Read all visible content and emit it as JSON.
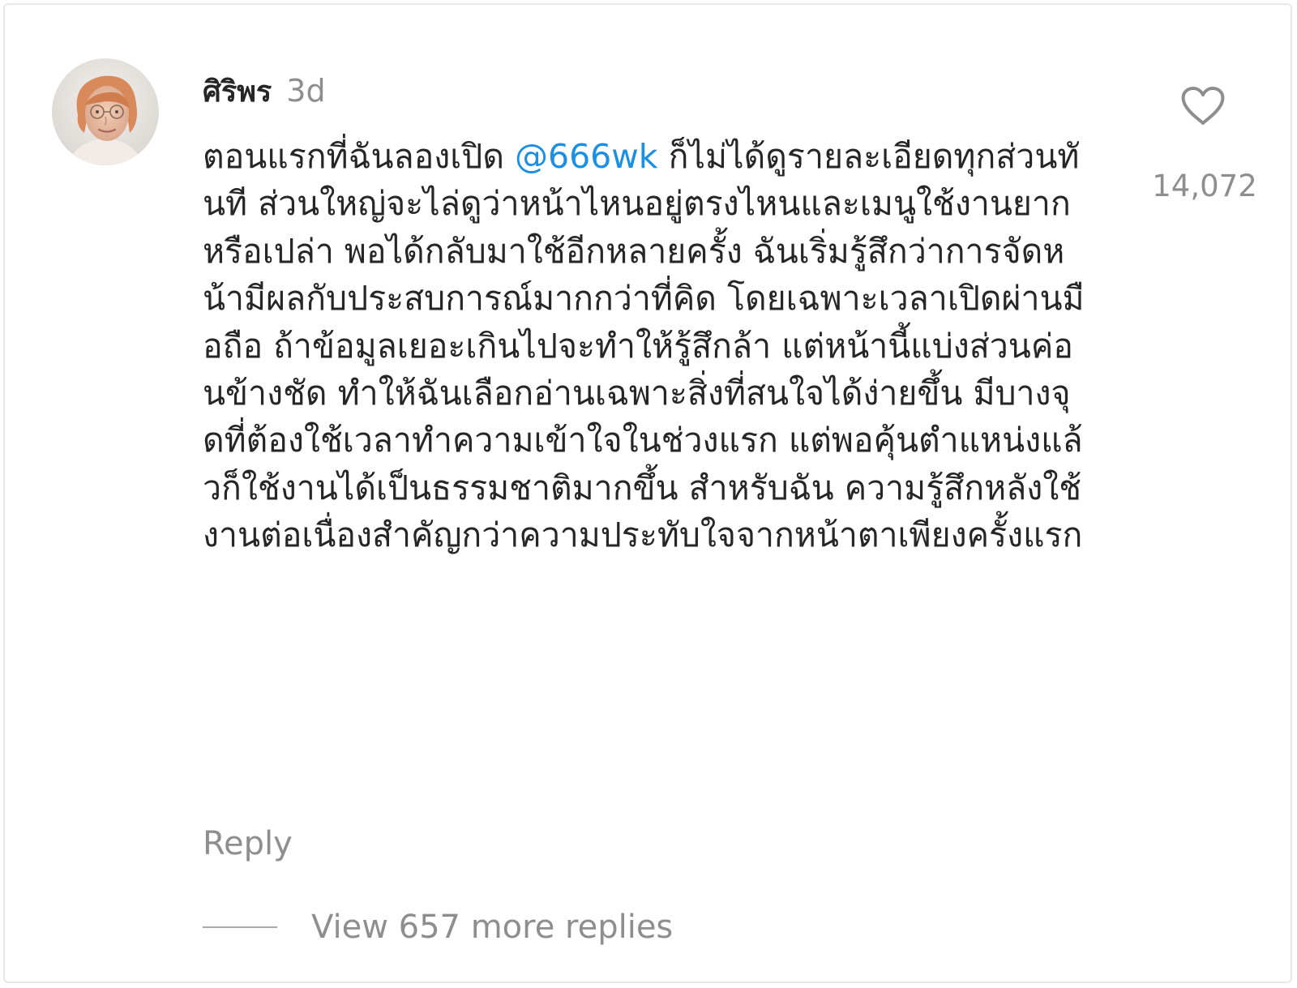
{
  "comment": {
    "username": "ศิริพร",
    "timestamp": "3d",
    "text_before_mention": "ตอนแรกที่ฉันลองเปิด ",
    "mention": "@666wk",
    "text_after_mention": " ก็ไม่ได้ดูรายละเอียดทุกส่วนทันที ส่วนใหญ่จะไล่ดูว่าหน้าไหนอยู่ตรงไหนและเมนูใช้งานยากหรือเปล่า พอได้กลับมาใช้อีกหลายครั้ง ฉันเริ่มรู้สึกว่าการจัดหน้ามีผลกับประสบการณ์มากกว่าที่คิด โดยเฉพาะเวลาเปิดผ่านมือถือ ถ้าข้อมูลเยอะเกินไปจะทำให้รู้สึกล้า แต่หน้านี้แบ่งส่วนค่อนข้างชัด ทำให้ฉันเลือกอ่านเฉพาะสิ่งที่สนใจได้ง่ายขึ้น มีบางจุดที่ต้องใช้เวลาทำความเข้าใจในช่วงแรก แต่พอคุ้นตำแหน่งแล้วก็ใช้งานได้เป็นธรรมชาติมากขึ้น สำหรับฉัน ความรู้สึกหลังใช้งานต่อเนื่องสำคัญกว่าความประทับใจจากหน้าตาเพียงครั้งแรก",
    "like_count": "14,072",
    "like_icon": "heart-outline-icon",
    "reply_label": "Reply",
    "view_replies_label": "View 657 more replies"
  },
  "colors": {
    "text": "#262626",
    "muted": "#8e8e8e",
    "mention": "#1a8fe3"
  }
}
